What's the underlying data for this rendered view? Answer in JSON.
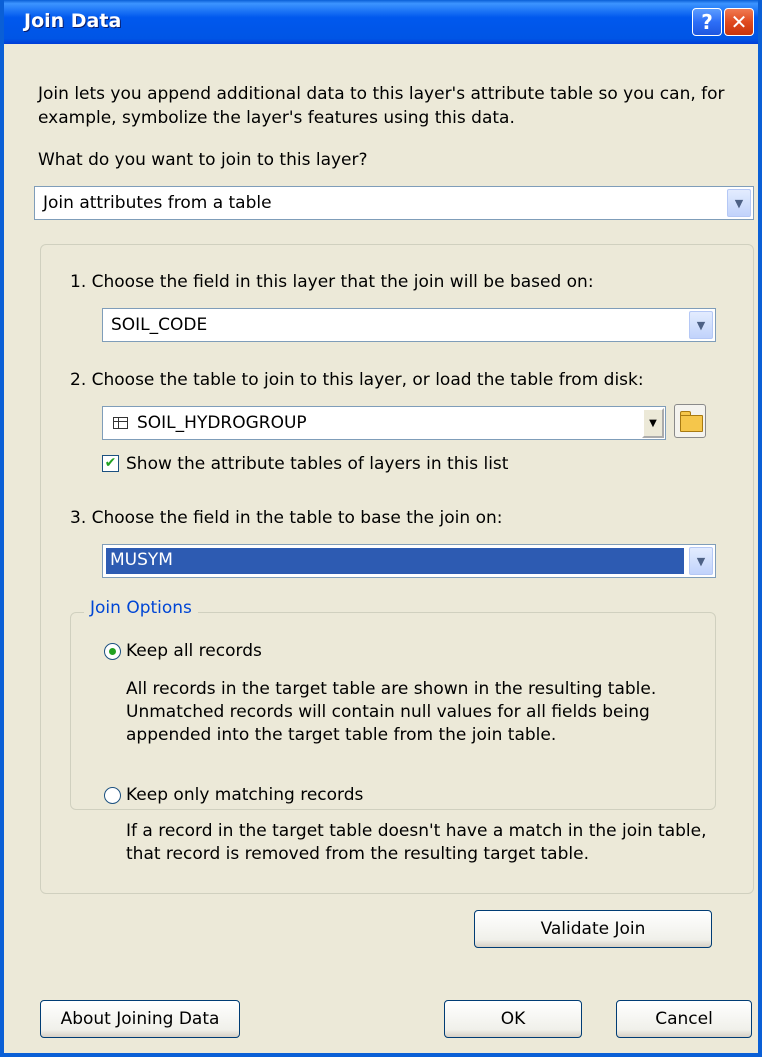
{
  "window": {
    "title": "Join Data"
  },
  "titlebar": {
    "help_glyph": "?",
    "close_glyph": "✕"
  },
  "intro": "Join lets you append additional data to this layer's attribute table so you can, for example, symbolize the layer's features using this data.",
  "question": "What do you want to join to this layer?",
  "join_type": {
    "value": "Join attributes from a table"
  },
  "steps": {
    "step1": {
      "label": "1.  Choose the field in this layer that the join will be based on:",
      "value": "SOIL_CODE"
    },
    "step2": {
      "label": "2.  Choose the table to join to this layer, or load the table from disk:",
      "value": "SOIL_HYDROGROUP",
      "checkbox_label": "Show the attribute tables of layers in this list",
      "checkbox_checked": true
    },
    "step3": {
      "label": "3.  Choose the field in the table to base the join on:",
      "value": "MUSYM"
    }
  },
  "join_options": {
    "legend": "Join Options",
    "options": [
      {
        "label": "Keep all records",
        "selected": true,
        "description": "All records in the target table are shown in the resulting table. Unmatched records will contain null values for all fields being appended into the target table from the join table."
      },
      {
        "label": "Keep only matching records",
        "selected": false,
        "description": "If a record in the target table doesn't have a match in the join table, that record is removed from the resulting target table."
      }
    ]
  },
  "buttons": {
    "validate": "Validate Join",
    "about": "About Joining Data",
    "ok": "OK",
    "cancel": "Cancel"
  },
  "icons": {
    "dropdown": "▼",
    "check": "✔"
  },
  "colors": {
    "titlebar": "#0058ee",
    "selection": "#2d5bb2",
    "legend_text": "#0046d5",
    "dialog_bg": "#ece9d8"
  }
}
